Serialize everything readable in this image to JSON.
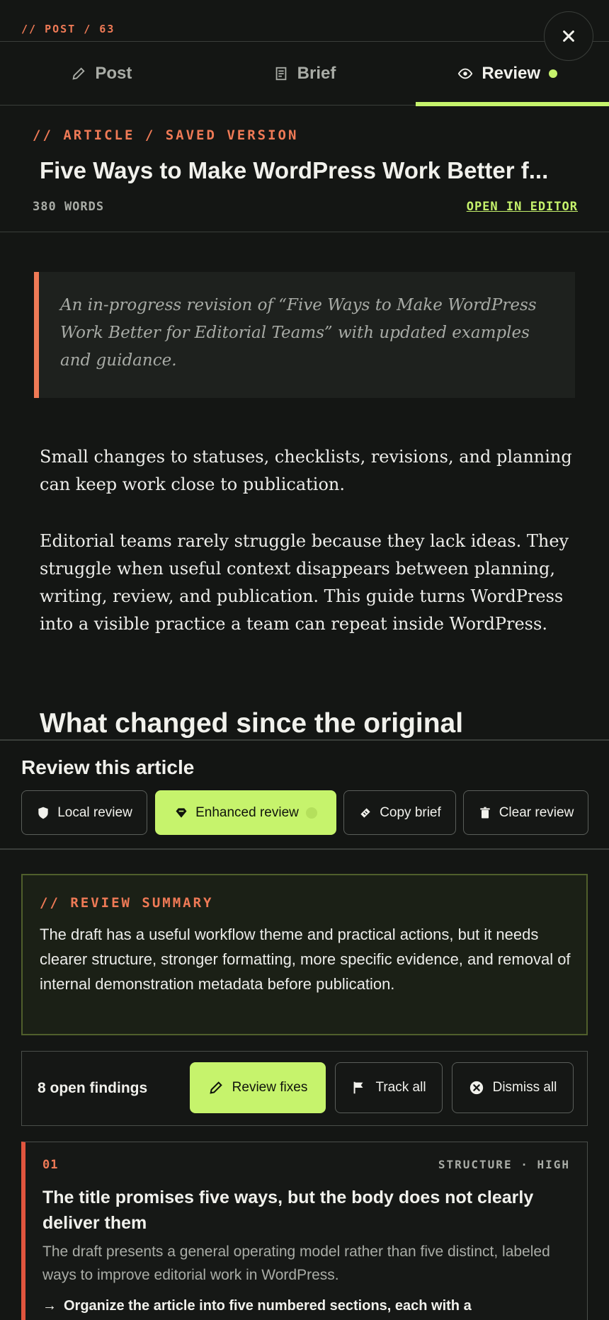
{
  "header": {
    "crumb": "// POST / 63",
    "close_icon": "close-icon"
  },
  "tabs": [
    {
      "label": "Post",
      "icon": "pencil-icon"
    },
    {
      "label": "Brief",
      "icon": "document-icon"
    },
    {
      "label": "Review",
      "icon": "eye-icon",
      "active": true
    }
  ],
  "article": {
    "crumb": "// ARTICLE / SAVED VERSION",
    "title": "Five Ways to Make WordPress Work Better f...",
    "word_count": "380 WORDS",
    "open_in_editor": "OPEN IN EDITOR",
    "excerpt": "An in-progress revision of “Five Ways to Make WordPress Work Better for Editorial Teams” with updated examples and guidance.",
    "paragraphs": [
      "Small changes to statuses, checklists, revisions, and planning can keep work close to publication.",
      "Editorial teams rarely struggle because they lack ideas. They struggle when useful context disappears between planning, writing, review, and publication. This guide turns WordPress into a visible practice a team can repeat inside WordPress."
    ],
    "heading": "What changed since the original"
  },
  "review": {
    "title": "Review this article",
    "buttons": [
      {
        "label": "Local review",
        "icon": "shield-icon"
      },
      {
        "label": "Enhanced review",
        "icon": "gem-icon"
      },
      {
        "label": "Copy brief",
        "icon": "clipboard-icon"
      },
      {
        "label": "Clear review",
        "icon": "trash-icon"
      }
    ]
  },
  "summary": {
    "label": "// REVIEW SUMMARY",
    "text": "The draft has a useful workflow theme and practical actions, but it needs clearer structure, stronger formatting, more specific evidence, and removal of internal demonstration metadata before publication."
  },
  "findings_bar": {
    "count_label": "8 open findings",
    "buttons": [
      {
        "label": "Review fixes",
        "icon": "pencil-icon"
      },
      {
        "label": "Track all",
        "icon": "flag-icon"
      },
      {
        "label": "Dismiss all",
        "icon": "x-circle-icon"
      }
    ]
  },
  "finding": {
    "number": "01",
    "meta": "STRUCTURE · HIGH",
    "title": "The title promises five ways, but the body does not clearly deliver them",
    "description": "The draft presents a general operating model rather than five distinct, labeled ways to improve editorial work in WordPress.",
    "action_arrow": "→",
    "action": "Organize the article into five numbered sections, each with a"
  },
  "colors": {
    "accent": "#c6f36c",
    "orange": "#ef7a56",
    "background": "#141614"
  }
}
